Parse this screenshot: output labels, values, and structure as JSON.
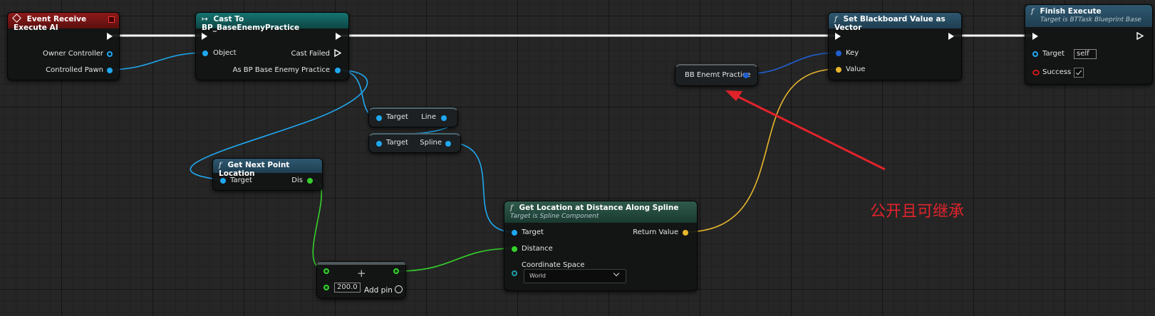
{
  "colors": {
    "exec_wire": "#ffffff",
    "object_wire": "#1fa8f0",
    "float_wire": "#35d12c",
    "vector_wire": "#e8b62c",
    "event_header": "#7a1414",
    "cast_header": "#0f5c5a",
    "function_header": "#274a5e",
    "annotation": "#e0232b"
  },
  "event_node": {
    "title": "Event Receive Execute AI",
    "pins": {
      "owner_controller": "Owner Controller",
      "controlled_pawn": "Controlled Pawn"
    }
  },
  "cast_node": {
    "title": "Cast To BP_BaseEnemyPractice",
    "pins": {
      "object": "Object",
      "cast_failed": "Cast Failed",
      "as_bp": "As BP Base Enemy Practice"
    }
  },
  "line_node": {
    "target": "Target",
    "output": "Line"
  },
  "spline_node": {
    "target": "Target",
    "output": "Spline"
  },
  "next_point_node": {
    "title": "Get Next Point Location",
    "pins": {
      "target": "Target",
      "dis": "Dis"
    }
  },
  "add_node": {
    "value": "200.0",
    "add_pin": "Add pin"
  },
  "spline_loc_node": {
    "title": "Get Location at Distance Along Spline",
    "subtitle": "Target is Spline Component",
    "pins": {
      "target": "Target",
      "distance": "Distance",
      "coordinate_space": "Coordinate Space",
      "return_value": "Return Value"
    },
    "coordinate_space_value": "World"
  },
  "bb_var_node": {
    "label": "BB Enemt Practice"
  },
  "set_bb_node": {
    "title": "Set Blackboard Value as Vector",
    "pins": {
      "key": "Key",
      "value": "Value"
    }
  },
  "finish_node": {
    "title": "Finish Execute",
    "subtitle": "Target is BTTask Blueprint Base",
    "pins": {
      "target": "Target",
      "success": "Success"
    },
    "target_value": "self",
    "success_checked": true
  },
  "annotation": {
    "text": "公开且可继承"
  }
}
